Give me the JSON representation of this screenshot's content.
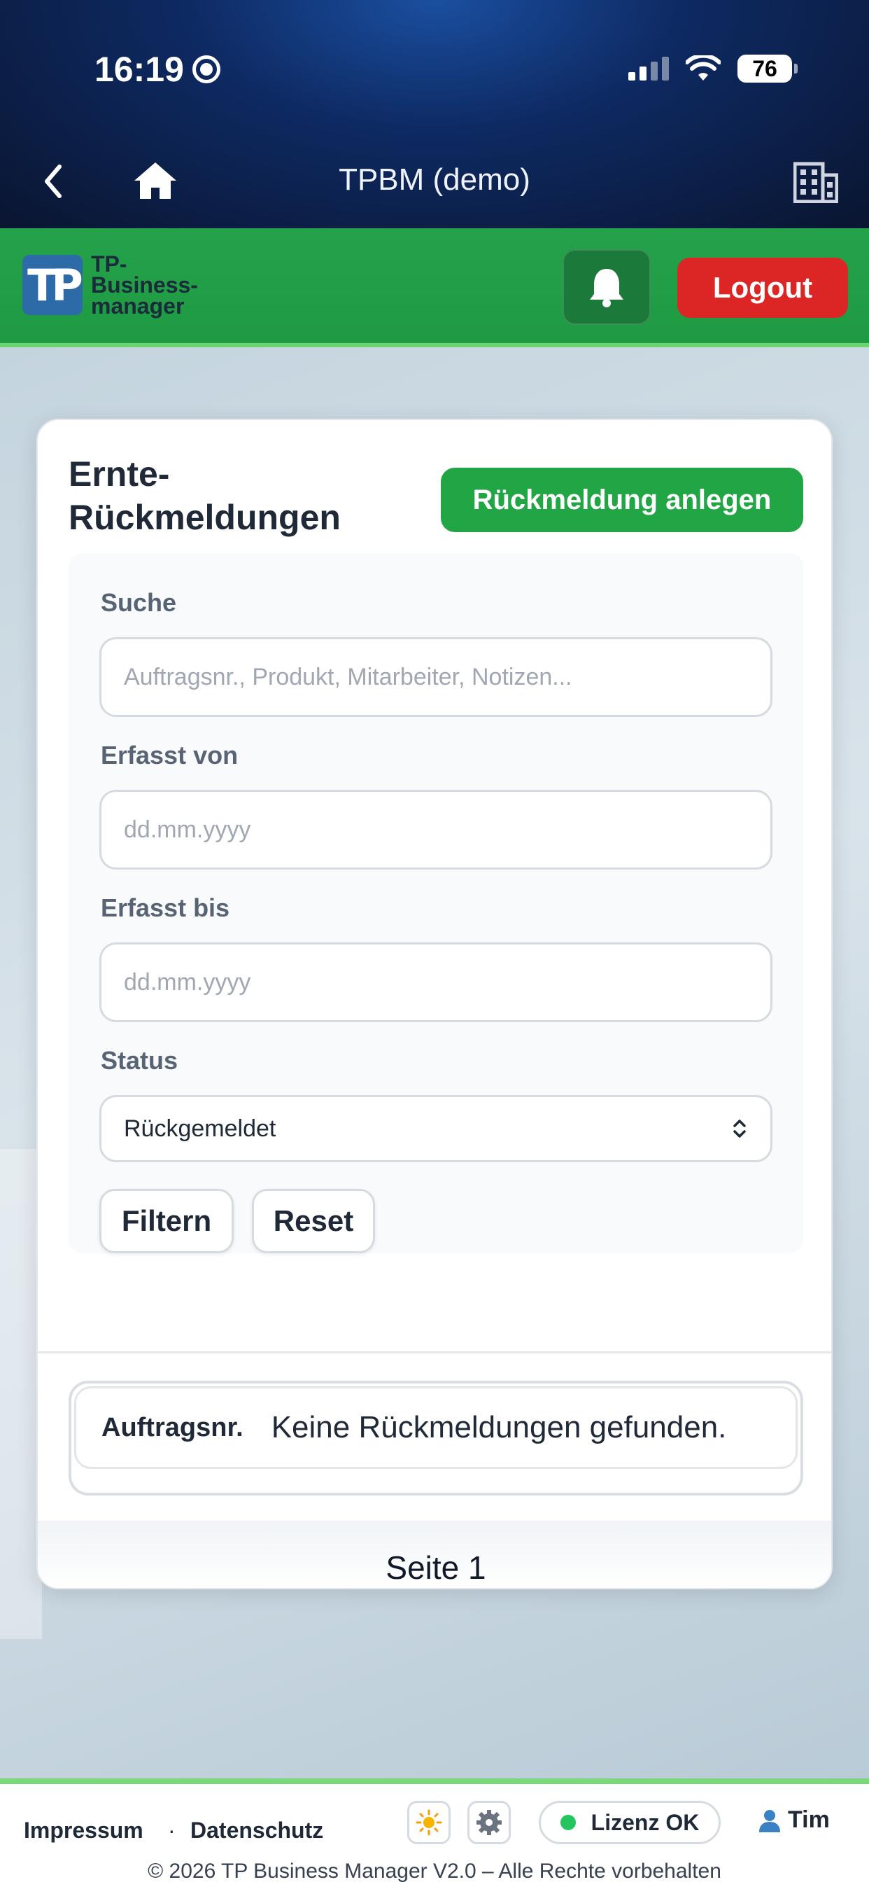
{
  "status_bar": {
    "time": "16:19",
    "battery": "76"
  },
  "nav": {
    "title": "TPBM (demo)"
  },
  "header": {
    "logo_mark": "TP",
    "logo_text": [
      "TP-",
      "Business-",
      "manager"
    ],
    "logout_label": "Logout"
  },
  "card": {
    "title": "Ernte-\nRückmeldungen",
    "create_label": "Rückmeldung anlegen",
    "filters": {
      "search_label": "Suche",
      "search_placeholder": "Auftragsnr., Produkt, Mitarbeiter, Notizen...",
      "from_label": "Erfasst von",
      "from_placeholder": "dd.mm.yyyy",
      "to_label": "Erfasst bis",
      "to_placeholder": "dd.mm.yyyy",
      "status_label": "Status",
      "status_value": "Rückgemeldet",
      "filter_label": "Filtern",
      "reset_label": "Reset"
    },
    "table": {
      "header": "Auftragsnr.",
      "empty_message": "Keine Rückmeldungen gefunden."
    },
    "pager": "Seite 1"
  },
  "footer": {
    "impressum": "Impressum",
    "separator": "·",
    "datenschutz": "Datenschutz",
    "license": "Lizenz OK",
    "user": "Tim",
    "copyright": "© 2026 TP Business Manager V2.0 – Alle Rechte vorbehalten"
  },
  "colors": {
    "header_green": "#22a04a",
    "logout_red": "#dc2626",
    "primary_green": "#22a545",
    "license_dot": "#22c55e"
  }
}
